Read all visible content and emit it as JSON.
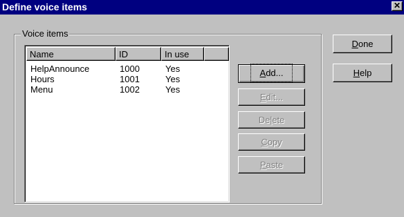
{
  "window": {
    "title": "Define voice items",
    "close_glyph": "✕"
  },
  "group": {
    "label": "Voice items"
  },
  "list": {
    "columns": [
      "Name",
      "ID",
      "In use"
    ],
    "rows": [
      {
        "name": "HelpAnnounce",
        "id": "1000",
        "in_use": "Yes"
      },
      {
        "name": "Hours",
        "id": "1001",
        "in_use": "Yes"
      },
      {
        "name": "Menu",
        "id": "1002",
        "in_use": "Yes"
      }
    ]
  },
  "buttons": {
    "add": {
      "pre": "",
      "mnemonic": "A",
      "post": "dd...",
      "enabled": true
    },
    "edit": {
      "pre": "",
      "mnemonic": "E",
      "post": "dit...",
      "enabled": false
    },
    "delete": {
      "pre": "De",
      "mnemonic": "l",
      "post": "ete",
      "enabled": false
    },
    "copy": {
      "pre": "",
      "mnemonic": "C",
      "post": "opy",
      "enabled": false
    },
    "paste": {
      "pre": "",
      "mnemonic": "P",
      "post": "aste",
      "enabled": false
    },
    "done": {
      "pre": "",
      "mnemonic": "D",
      "post": "one",
      "enabled": true
    },
    "help": {
      "pre": "",
      "mnemonic": "H",
      "post": "elp",
      "enabled": true
    }
  },
  "colors": {
    "titlebar": "#000080",
    "face": "#c0c0c0",
    "disabled_text": "#808080"
  }
}
